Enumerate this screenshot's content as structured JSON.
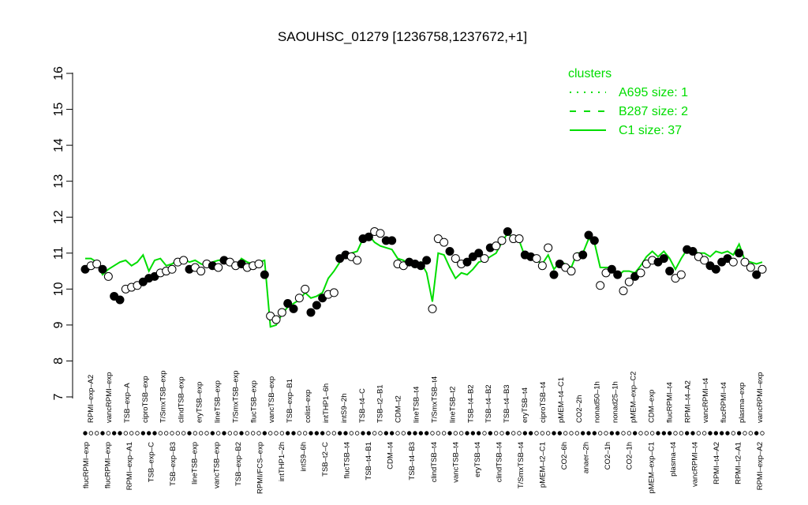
{
  "chart_data": {
    "type": "scatter",
    "title": "SAOUHSC_01279 [1236758,1237672,+1]",
    "ylim": [
      7,
      16
    ],
    "yticks": [
      7,
      8,
      9,
      10,
      11,
      12,
      13,
      14,
      15,
      16
    ],
    "grid": false,
    "legend": {
      "title": "clusters",
      "placement": "top-right",
      "entries": [
        {
          "label": "A695 size: 1",
          "style": "dotted"
        },
        {
          "label": "B287 size: 2",
          "style": "dashed"
        },
        {
          "label": "C1 size: 37",
          "style": "solid"
        }
      ]
    },
    "x_labels_top": [
      "RPMI–exp–A2",
      "vancRPMI–exp",
      "TSB–exp–A",
      "ciproTSB–exp",
      "T/SmxTSB–exp",
      "clindTSB–exp",
      "eryTSB–exp",
      "lineTSB–exp",
      "T/SmxTSB–exp",
      "flucTSB–exp",
      "vancTSB–exp",
      "TSB–exp–B1",
      "colist–exp",
      "intTHP1–6h",
      "intS9–2h",
      "TSB–t4–C",
      "TSB–t2–B1",
      "CDM–t2",
      "lineTSB–t4",
      "T/SmxTSB–t4",
      "lineTSB–t2",
      "TSB–t4–B2",
      "TSB–t4–B2",
      "TSB–t4–B3",
      "eryTSB–t4",
      "ciproTSB–t4",
      "pMEM–t4–C1",
      "CO2–2h",
      "nonad50–1h",
      "nonad25–1h",
      "pMEM–exp–C2",
      "CDM–exp",
      "flucRPMI–t4",
      "RPMI–t4–A2",
      "vancRPMI–t4",
      "flucRPMI–t4",
      "plasma–exp",
      "vancRPMI–exp"
    ],
    "x_labels_bottom": [
      "flucRPMI–exp",
      "flucRPMI–exp",
      "RPMI–exp–A1",
      "TSB–exp–C",
      "TSB–exp–B3",
      "lineTSB–exp",
      "vancTSB–exp",
      "TSB–exp–B2",
      "RPMI/FCS–exp",
      "intTHP1–2h",
      "intS9–6h",
      "TSB–t2–C",
      "flucTSB–t4",
      "TSB–t4–B1",
      "CDM–t4",
      "TSB–t4–B3",
      "clindTSB–t4",
      "vancTSB–t4",
      "eryTSB–t4",
      "clindTSB–t4",
      "T/SmxTSB–t4",
      "pMEM–t2–C1",
      "CO2–6h",
      "anaer–2h",
      "CO2–1h",
      "CO2–1h",
      "pMEM–exp–C1",
      "plasma–t4",
      "vancRPMI–t4",
      "RPMI–t4–A2",
      "RPMI–t2–A1",
      "RPMI–exp–A2"
    ],
    "points": [
      {
        "x": 1,
        "y": 10.55,
        "filled": true
      },
      {
        "x": 2,
        "y": 10.65,
        "filled": false
      },
      {
        "x": 3,
        "y": 10.7,
        "filled": false
      },
      {
        "x": 4,
        "y": 10.55,
        "filled": true
      },
      {
        "x": 5,
        "y": 10.35,
        "filled": false
      },
      {
        "x": 6,
        "y": 9.8,
        "filled": true
      },
      {
        "x": 7,
        "y": 9.7,
        "filled": true
      },
      {
        "x": 8,
        "y": 10.0,
        "filled": false
      },
      {
        "x": 9,
        "y": 10.05,
        "filled": false
      },
      {
        "x": 10,
        "y": 10.1,
        "filled": false
      },
      {
        "x": 11,
        "y": 10.2,
        "filled": true
      },
      {
        "x": 12,
        "y": 10.3,
        "filled": true
      },
      {
        "x": 13,
        "y": 10.35,
        "filled": true
      },
      {
        "x": 14,
        "y": 10.45,
        "filled": false
      },
      {
        "x": 15,
        "y": 10.5,
        "filled": false
      },
      {
        "x": 16,
        "y": 10.55,
        "filled": false
      },
      {
        "x": 17,
        "y": 10.75,
        "filled": false
      },
      {
        "x": 18,
        "y": 10.8,
        "filled": false
      },
      {
        "x": 19,
        "y": 10.55,
        "filled": true
      },
      {
        "x": 20,
        "y": 10.6,
        "filled": false
      },
      {
        "x": 21,
        "y": 10.5,
        "filled": false
      },
      {
        "x": 22,
        "y": 10.7,
        "filled": false
      },
      {
        "x": 23,
        "y": 10.65,
        "filled": true
      },
      {
        "x": 24,
        "y": 10.6,
        "filled": false
      },
      {
        "x": 25,
        "y": 10.8,
        "filled": true
      },
      {
        "x": 26,
        "y": 10.75,
        "filled": false
      },
      {
        "x": 27,
        "y": 10.65,
        "filled": false
      },
      {
        "x": 28,
        "y": 10.7,
        "filled": true
      },
      {
        "x": 29,
        "y": 10.6,
        "filled": false
      },
      {
        "x": 30,
        "y": 10.65,
        "filled": false
      },
      {
        "x": 31,
        "y": 10.7,
        "filled": false
      },
      {
        "x": 32,
        "y": 10.4,
        "filled": true
      },
      {
        "x": 33,
        "y": 9.25,
        "filled": false
      },
      {
        "x": 34,
        "y": 9.15,
        "filled": false
      },
      {
        "x": 35,
        "y": 9.35,
        "filled": false
      },
      {
        "x": 36,
        "y": 9.6,
        "filled": true
      },
      {
        "x": 37,
        "y": 9.45,
        "filled": true
      },
      {
        "x": 38,
        "y": 9.75,
        "filled": false
      },
      {
        "x": 39,
        "y": 10.0,
        "filled": false
      },
      {
        "x": 40,
        "y": 9.35,
        "filled": true
      },
      {
        "x": 41,
        "y": 9.55,
        "filled": true
      },
      {
        "x": 42,
        "y": 9.75,
        "filled": true
      },
      {
        "x": 43,
        "y": 9.85,
        "filled": false
      },
      {
        "x": 44,
        "y": 9.9,
        "filled": false
      },
      {
        "x": 45,
        "y": 10.85,
        "filled": true
      },
      {
        "x": 46,
        "y": 10.95,
        "filled": true
      },
      {
        "x": 47,
        "y": 10.9,
        "filled": false
      },
      {
        "x": 48,
        "y": 10.8,
        "filled": false
      },
      {
        "x": 49,
        "y": 11.4,
        "filled": true
      },
      {
        "x": 50,
        "y": 11.45,
        "filled": true
      },
      {
        "x": 51,
        "y": 11.6,
        "filled": false
      },
      {
        "x": 52,
        "y": 11.55,
        "filled": false
      },
      {
        "x": 53,
        "y": 11.35,
        "filled": true
      },
      {
        "x": 54,
        "y": 11.35,
        "filled": true
      },
      {
        "x": 55,
        "y": 10.7,
        "filled": false
      },
      {
        "x": 56,
        "y": 10.65,
        "filled": false
      },
      {
        "x": 57,
        "y": 10.75,
        "filled": true
      },
      {
        "x": 58,
        "y": 10.7,
        "filled": true
      },
      {
        "x": 59,
        "y": 10.65,
        "filled": true
      },
      {
        "x": 60,
        "y": 10.8,
        "filled": true
      },
      {
        "x": 61,
        "y": 9.45,
        "filled": false
      },
      {
        "x": 62,
        "y": 11.4,
        "filled": false
      },
      {
        "x": 63,
        "y": 11.3,
        "filled": false
      },
      {
        "x": 64,
        "y": 11.05,
        "filled": true
      },
      {
        "x": 65,
        "y": 10.85,
        "filled": false
      },
      {
        "x": 66,
        "y": 10.7,
        "filled": false
      },
      {
        "x": 67,
        "y": 10.75,
        "filled": true
      },
      {
        "x": 68,
        "y": 10.9,
        "filled": true
      },
      {
        "x": 69,
        "y": 11.0,
        "filled": true
      },
      {
        "x": 70,
        "y": 10.85,
        "filled": false
      },
      {
        "x": 71,
        "y": 11.15,
        "filled": true
      },
      {
        "x": 72,
        "y": 11.2,
        "filled": false
      },
      {
        "x": 73,
        "y": 11.35,
        "filled": false
      },
      {
        "x": 74,
        "y": 11.6,
        "filled": true
      },
      {
        "x": 75,
        "y": 11.4,
        "filled": false
      },
      {
        "x": 76,
        "y": 11.4,
        "filled": false
      },
      {
        "x": 77,
        "y": 10.95,
        "filled": true
      },
      {
        "x": 78,
        "y": 10.9,
        "filled": true
      },
      {
        "x": 79,
        "y": 10.85,
        "filled": false
      },
      {
        "x": 80,
        "y": 10.65,
        "filled": false
      },
      {
        "x": 81,
        "y": 11.15,
        "filled": false
      },
      {
        "x": 82,
        "y": 10.4,
        "filled": true
      },
      {
        "x": 83,
        "y": 10.7,
        "filled": true
      },
      {
        "x": 84,
        "y": 10.6,
        "filled": false
      },
      {
        "x": 85,
        "y": 10.5,
        "filled": false
      },
      {
        "x": 86,
        "y": 10.9,
        "filled": false
      },
      {
        "x": 87,
        "y": 10.95,
        "filled": true
      },
      {
        "x": 88,
        "y": 11.5,
        "filled": true
      },
      {
        "x": 89,
        "y": 11.35,
        "filled": true
      },
      {
        "x": 90,
        "y": 10.1,
        "filled": false
      },
      {
        "x": 91,
        "y": 10.45,
        "filled": false
      },
      {
        "x": 92,
        "y": 10.55,
        "filled": true
      },
      {
        "x": 93,
        "y": 10.4,
        "filled": true
      },
      {
        "x": 94,
        "y": 9.95,
        "filled": false
      },
      {
        "x": 95,
        "y": 10.2,
        "filled": false
      },
      {
        "x": 96,
        "y": 10.35,
        "filled": true
      },
      {
        "x": 97,
        "y": 10.45,
        "filled": false
      },
      {
        "x": 98,
        "y": 10.7,
        "filled": false
      },
      {
        "x": 99,
        "y": 10.8,
        "filled": false
      },
      {
        "x": 100,
        "y": 10.75,
        "filled": true
      },
      {
        "x": 101,
        "y": 10.85,
        "filled": true
      },
      {
        "x": 102,
        "y": 10.5,
        "filled": true
      },
      {
        "x": 103,
        "y": 10.3,
        "filled": false
      },
      {
        "x": 104,
        "y": 10.4,
        "filled": false
      },
      {
        "x": 105,
        "y": 11.1,
        "filled": true
      },
      {
        "x": 106,
        "y": 11.05,
        "filled": true
      },
      {
        "x": 107,
        "y": 10.9,
        "filled": false
      },
      {
        "x": 108,
        "y": 10.8,
        "filled": false
      },
      {
        "x": 109,
        "y": 10.65,
        "filled": true
      },
      {
        "x": 110,
        "y": 10.55,
        "filled": true
      },
      {
        "x": 111,
        "y": 10.75,
        "filled": true
      },
      {
        "x": 112,
        "y": 10.85,
        "filled": true
      },
      {
        "x": 113,
        "y": 10.75,
        "filled": false
      },
      {
        "x": 114,
        "y": 11.0,
        "filled": true
      },
      {
        "x": 115,
        "y": 10.75,
        "filled": false
      },
      {
        "x": 116,
        "y": 10.6,
        "filled": false
      },
      {
        "x": 117,
        "y": 10.4,
        "filled": true
      },
      {
        "x": 118,
        "y": 10.55,
        "filled": false
      }
    ],
    "series": [
      {
        "name": "C1 size: 37",
        "style": "solid",
        "values": [
          10.85,
          10.85,
          10.75,
          10.4,
          10.55,
          10.65,
          10.75,
          10.8,
          10.65,
          10.75,
          10.95,
          10.5,
          10.8,
          10.85,
          10.65,
          10.7,
          10.8,
          10.85,
          10.75,
          10.8,
          10.7,
          10.65,
          10.75,
          10.8,
          10.8,
          10.8,
          10.6,
          10.85,
          10.75,
          10.7,
          10.75,
          10.8,
          8.95,
          9.0,
          9.3,
          9.5,
          9.6,
          9.7,
          9.9,
          9.75,
          9.8,
          9.9,
          10.3,
          10.5,
          10.75,
          10.9,
          11.0,
          11.05,
          11.4,
          11.5,
          11.3,
          11.2,
          11.15,
          11.1,
          10.85,
          10.8,
          10.7,
          10.6,
          10.75,
          10.45,
          9.65,
          11.0,
          10.95,
          10.6,
          10.3,
          10.45,
          10.4,
          10.55,
          10.75,
          10.8,
          10.9,
          11.0,
          11.3,
          11.55,
          11.4,
          11.35,
          10.9,
          10.9,
          10.8,
          10.7,
          10.95,
          10.55,
          10.75,
          10.7,
          10.6,
          11.0,
          11.0,
          11.4,
          11.3,
          10.6,
          10.6,
          10.6,
          10.35,
          10.5,
          10.5,
          10.45,
          10.65,
          10.9,
          11.05,
          10.9,
          11.05,
          10.85,
          10.55,
          10.85,
          11.1,
          11.05,
          11.0,
          11.0,
          10.9,
          11.05,
          11.0,
          11.05,
          10.95,
          11.25,
          10.8,
          10.75,
          10.7,
          10.75
        ]
      }
    ]
  }
}
